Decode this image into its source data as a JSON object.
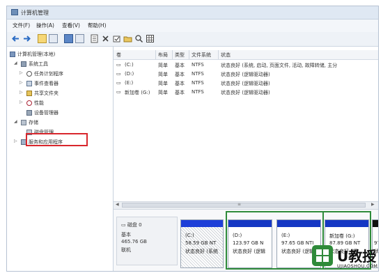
{
  "window": {
    "title": "计算机管理"
  },
  "menu": [
    {
      "label": "文件(F)"
    },
    {
      "label": "操作(A)"
    },
    {
      "label": "查看(V)"
    },
    {
      "label": "帮助(H)"
    }
  ],
  "tree": [
    {
      "label": "计算机管理(本地)",
      "arrow": ""
    },
    {
      "label": "系统工具",
      "arrow": "◢"
    },
    {
      "label": "任务计划程序",
      "arrow": "▷"
    },
    {
      "label": "事件查看器",
      "arrow": "▷"
    },
    {
      "label": "共享文件夹",
      "arrow": "▷"
    },
    {
      "label": "性能",
      "arrow": "▷"
    },
    {
      "label": "设备管理器",
      "arrow": ""
    },
    {
      "label": "存储",
      "arrow": "◢"
    },
    {
      "label": "磁盘管理",
      "arrow": ""
    },
    {
      "label": "服务和应用程序",
      "arrow": "▷"
    }
  ],
  "columns": [
    {
      "label": "卷"
    },
    {
      "label": "布局"
    },
    {
      "label": "类型"
    },
    {
      "label": "文件系统"
    },
    {
      "label": "状态"
    }
  ],
  "volumes": [
    {
      "name": "(C:)",
      "layout": "简单",
      "type": "基本",
      "fs": "NTFS",
      "status": "状态良好 (系统, 启动, 页面文件, 活动, 故障转储, 主分"
    },
    {
      "name": "(D:)",
      "layout": "简单",
      "type": "基本",
      "fs": "NTFS",
      "status": "状态良好 (逻辑驱动器)"
    },
    {
      "name": "(E:)",
      "layout": "简单",
      "type": "基本",
      "fs": "NTFS",
      "status": "状态良好 (逻辑驱动器)"
    },
    {
      "name": "新加卷 (G:)",
      "layout": "简单",
      "type": "基本",
      "fs": "NTFS",
      "status": "状态良好 (逻辑驱动器)"
    }
  ],
  "disk": {
    "name": "磁盘 0",
    "type": "基本",
    "size": "465.76 GB",
    "status": "联机"
  },
  "partitions": [
    {
      "name": "(C:)",
      "size": "58.59 GB NT",
      "status": "状态良好 (系统"
    },
    {
      "name": "(D:)",
      "size": "123.97 GB N",
      "status": "状态良好 (逻辑"
    },
    {
      "name": "(E:)",
      "size": "97.65 GB NTI",
      "status": "状态良好 (逻辑"
    },
    {
      "name": "新加卷 (G:)",
      "size": "87.89 GB NT",
      "status": "状态良好 (逻"
    },
    {
      "name": "",
      "size": "97",
      "status": "状"
    }
  ],
  "watermark": {
    "brand": "U教授",
    "url": "UJIAOSHOU.COM"
  },
  "colors": {
    "primary_partition": "#1e3fd8",
    "logical_partition": "#1537c4",
    "highlight_red": "#d8262c",
    "highlight_green": "#2e8b3a"
  }
}
